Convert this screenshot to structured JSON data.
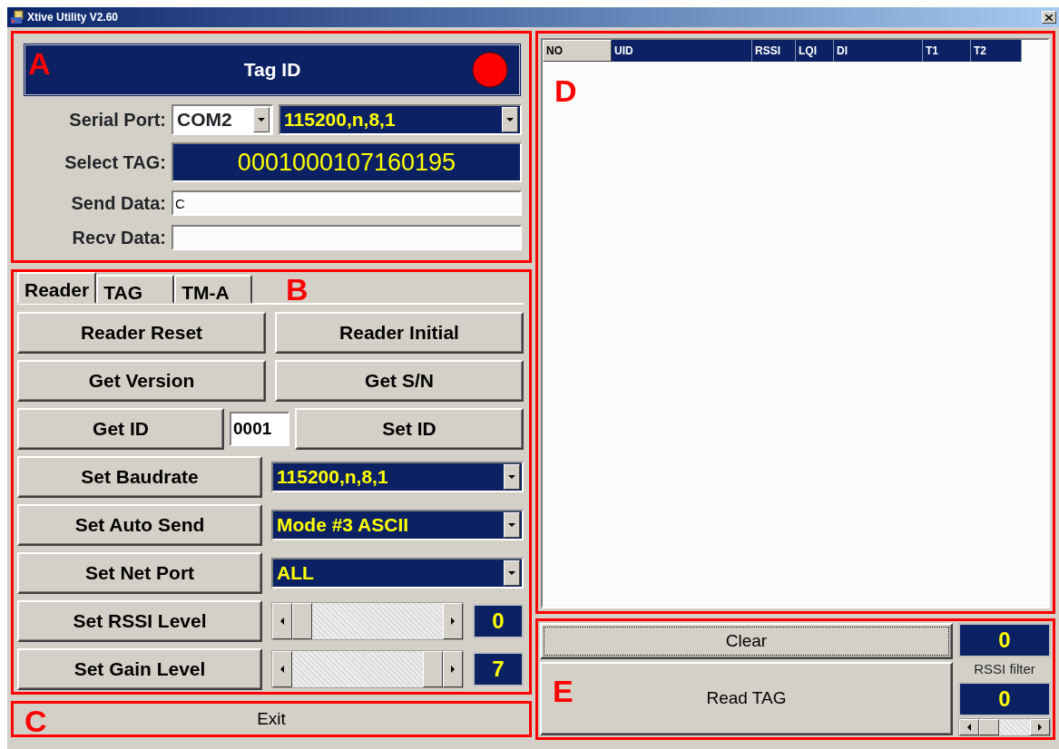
{
  "window": {
    "title": "Xtive Utility V2.60"
  },
  "connection_panel": {
    "marker": "A",
    "header": "Tag ID",
    "serial_port": {
      "label": "Serial Port:",
      "port": "COM2",
      "settings": "115200,n,8,1"
    },
    "select_tag": {
      "label": "Select TAG:",
      "value": "0001000107160195"
    },
    "send_data": {
      "label": "Send Data:",
      "value": "C"
    },
    "recv_data": {
      "label": "Recv Data:"
    }
  },
  "command_panel": {
    "marker": "B",
    "tabs": [
      {
        "label": "Reader",
        "selected": true
      },
      {
        "label": "TAG",
        "selected": false
      },
      {
        "label": "TM-A",
        "selected": false
      }
    ],
    "rows": [
      {
        "kind": "pair",
        "buttons": [
          "Reader Reset",
          "Reader Initial"
        ]
      },
      {
        "kind": "pair",
        "buttons": [
          "Get Version",
          "Get S/N"
        ]
      },
      {
        "kind": "id",
        "buttons": [
          "Get ID",
          "Set ID"
        ],
        "value": "0001"
      },
      {
        "kind": "select",
        "button": "Set Baudrate",
        "value": "115200,n,8,1"
      },
      {
        "kind": "select",
        "button": "Set Auto Send",
        "value": "Mode #3 ASCII"
      },
      {
        "kind": "select",
        "button": "Set Net Port",
        "value": "ALL"
      },
      {
        "kind": "slider",
        "button": "Set RSSI Level",
        "level": 0,
        "reading": "0"
      },
      {
        "kind": "slider",
        "button": "Set Gain Level",
        "level": 1,
        "reading": "7"
      }
    ]
  },
  "exit_panel": {
    "marker": "C",
    "button": "Exit"
  },
  "tag_list": {
    "marker": "D",
    "columns": [
      {
        "label": "NO",
        "selected": true
      },
      {
        "label": "UID",
        "selected": false
      },
      {
        "label": "RSSI",
        "selected": false
      },
      {
        "label": "LQI",
        "selected": false
      },
      {
        "label": "DI",
        "selected": false
      },
      {
        "label": "T1",
        "selected": false
      },
      {
        "label": "T2",
        "selected": false
      }
    ]
  },
  "read_panel": {
    "marker": "E",
    "clear_button": "Clear",
    "count": "0",
    "read_button": "Read TAG",
    "filter_label": "RSSI filter",
    "filter_value": "0",
    "filter_slider": {
      "level": 0
    }
  }
}
